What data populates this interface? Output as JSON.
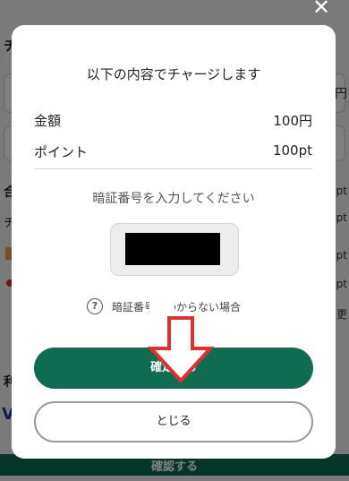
{
  "background": {
    "title": "チ",
    "unit": "円",
    "section": "合",
    "section_right": "pt",
    "row_left": "チ",
    "row_right_1": "pt",
    "row_right_2": "pt",
    "row_right_3": "pt",
    "row_right_4": "更",
    "section2": "利",
    "brand": "V",
    "bottom_button": "確認する"
  },
  "modal": {
    "close_glyph": "✕",
    "title": "以下の内容でチャージします",
    "rows": [
      {
        "label": "金額",
        "value": "100円"
      },
      {
        "label": "ポイント",
        "value": "100pt"
      }
    ],
    "pin_label": "暗証番号を入力してください",
    "help_icon": "?",
    "help_text": "暗証番号がわからない場合",
    "confirm_label": "確定する",
    "close_label": "とじる"
  },
  "colors": {
    "primary": "#0f6b52",
    "annotation_arrow": "#e03030"
  }
}
